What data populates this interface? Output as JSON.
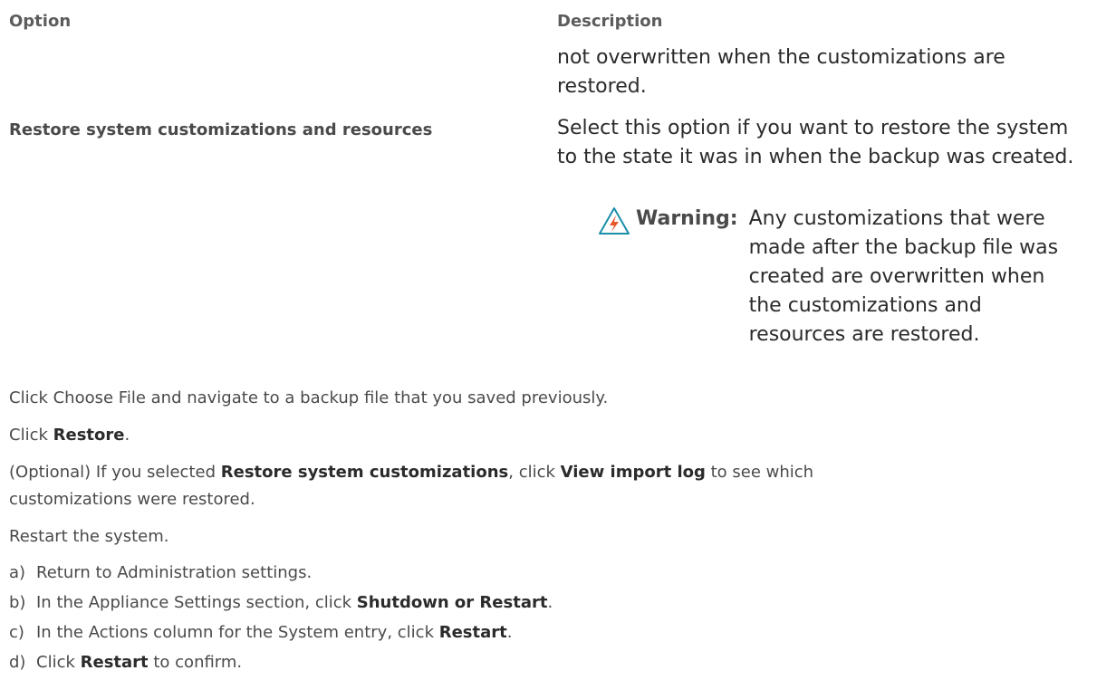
{
  "table": {
    "header_option": "Option",
    "header_description": "Description",
    "row1": {
      "option": "",
      "description": "not overwritten when the customizations are restored."
    },
    "row2": {
      "option": "Restore system customizations and resources",
      "description": "Select this option if you want to restore the system to the state it was in when the backup was created.",
      "warning_label": "Warning:",
      "warning_text": "Any customizations that were made after the backup file was created are overwritten when the customizations and resources are restored."
    }
  },
  "steps": {
    "step1": "Click Choose File and navigate to a backup file that you saved previously.",
    "step2_pre": "Click ",
    "step2_bold": "Restore",
    "step2_post": ".",
    "step3_pre": "(Optional) If you selected ",
    "step3_bold1": "Restore system customizations",
    "step3_mid": ", click ",
    "step3_bold2": "View import log",
    "step3_post": " to see which customizations were restored.",
    "step4": "Restart the system.",
    "substeps": [
      {
        "letter": "a)",
        "pre": "Return to Administration settings.",
        "bold": "",
        "post": ""
      },
      {
        "letter": "b)",
        "pre": "In the Appliance Settings section, click ",
        "bold": "Shutdown or Restart",
        "post": "."
      },
      {
        "letter": "c)",
        "pre": "In the Actions column for the System entry, click ",
        "bold": "Restart",
        "post": "."
      },
      {
        "letter": "d)",
        "pre": "Click ",
        "bold": "Restart",
        "post": " to confirm."
      }
    ]
  },
  "colors": {
    "warning_icon_stroke": "#1a8fa8",
    "warning_bolt": "#e8562a"
  },
  "icons": {
    "warning": "warning-triangle-icon"
  }
}
